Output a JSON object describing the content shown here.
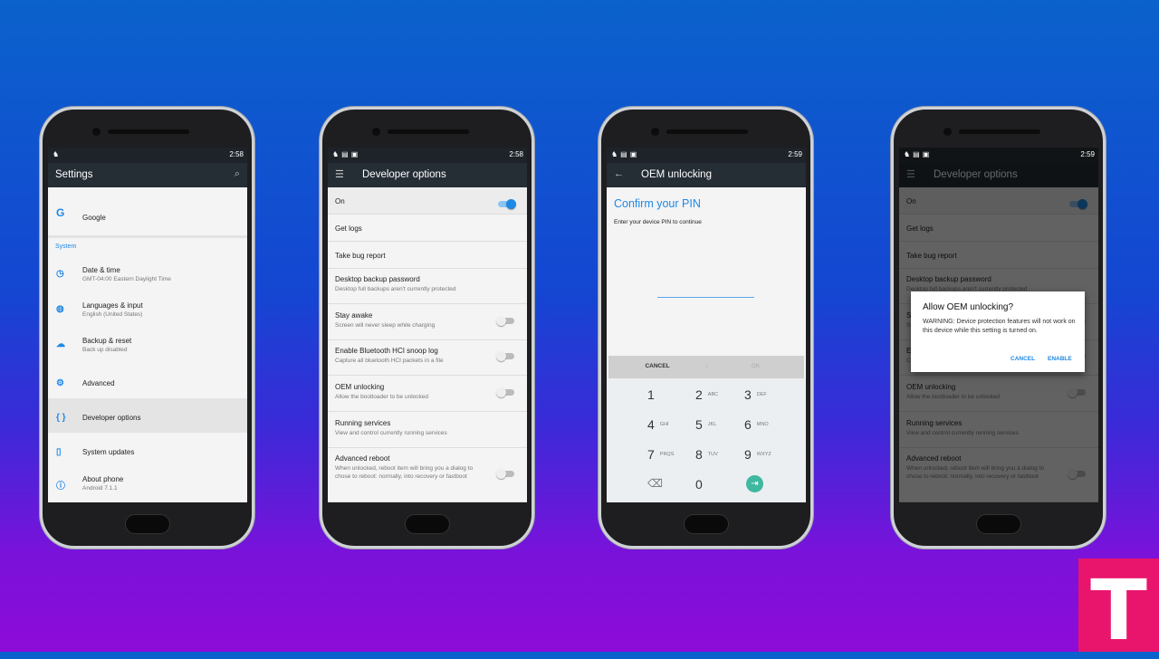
{
  "status_icons": {
    "left": "notification icons",
    "right_icons": "dnd wifi signal battery"
  },
  "phone1": {
    "time": "2:58",
    "title": "Settings",
    "search_icon": "search-icon",
    "google": "Google",
    "section": "System",
    "items": [
      {
        "icon": "clock-icon",
        "glyph": "◷",
        "title": "Date & time",
        "subtitle": "GMT-04:00 Eastern Daylight Time"
      },
      {
        "icon": "globe-icon",
        "glyph": "◍",
        "title": "Languages & input",
        "subtitle": "English (United States)"
      },
      {
        "icon": "cloud-upload-icon",
        "glyph": "☁",
        "title": "Backup & reset",
        "subtitle": "Back up disabled"
      },
      {
        "icon": "gear-icon",
        "glyph": "⚙",
        "title": "Advanced",
        "subtitle": ""
      },
      {
        "icon": "braces-icon",
        "glyph": "{ }",
        "title": "Developer options",
        "subtitle": ""
      },
      {
        "icon": "system-update-icon",
        "glyph": "▯",
        "title": "System updates",
        "subtitle": ""
      },
      {
        "icon": "info-icon",
        "glyph": "ⓘ",
        "title": "About phone",
        "subtitle": "Android 7.1.1"
      }
    ]
  },
  "phone2": {
    "time": "2:58",
    "title": "Developer options",
    "items": [
      {
        "title": "On",
        "subtitle": "",
        "toggle": "on"
      },
      {
        "title": "Get logs",
        "subtitle": ""
      },
      {
        "title": "Take bug report",
        "subtitle": ""
      },
      {
        "title": "Desktop backup password",
        "subtitle": "Desktop full backups aren't currently protected"
      },
      {
        "title": "Stay awake",
        "subtitle": "Screen will never sleep while charging",
        "toggle": "off"
      },
      {
        "title": "Enable Bluetooth HCI snoop log",
        "subtitle": "Capture all bluetooth HCI packets in a file",
        "toggle": "off"
      },
      {
        "title": "OEM unlocking",
        "subtitle": "Allow the bootloader to be unlocked",
        "toggle": "off"
      },
      {
        "title": "Running services",
        "subtitle": "View and control currently running services"
      },
      {
        "title": "Advanced reboot",
        "subtitle": "When unlocked, reboot item will bring you a dialog to chose to reboot: normally, into recovery or fastboot",
        "toggle": "off"
      }
    ]
  },
  "phone3": {
    "time": "2:59",
    "title": "OEM unlocking",
    "heading": "Confirm your PIN",
    "subtitle": "Enter your device PIN to continue",
    "pin_value": "",
    "cancel": "CANCEL",
    "ok": "OK",
    "keys": [
      [
        "1",
        ""
      ],
      [
        "2",
        "ABC"
      ],
      [
        "3",
        "DEF"
      ],
      [
        "4",
        "GHI"
      ],
      [
        "5",
        "JKL"
      ],
      [
        "6",
        "MNO"
      ],
      [
        "7",
        "PRQS"
      ],
      [
        "8",
        "TUV"
      ],
      [
        "9",
        "WXYZ"
      ],
      [
        "⌫",
        ""
      ],
      [
        "0",
        ""
      ],
      [
        "⇥",
        ""
      ]
    ]
  },
  "phone4": {
    "time": "2:59",
    "dialog_title": "Allow OEM unlocking?",
    "dialog_body": "WARNING: Device protection features will not work on this device while this setting is turned on.",
    "cancel": "CANCEL",
    "enable": "ENABLE"
  },
  "logo": {
    "letter": "T"
  },
  "colors": {
    "accent": "#1e88e5",
    "appbar": "#252d35",
    "logo": "#e9156c",
    "enter_key": "#3fb8a0"
  }
}
